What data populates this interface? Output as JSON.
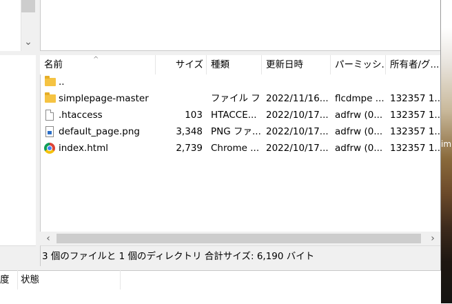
{
  "columns": [
    {
      "key": "name",
      "label": "名前"
    },
    {
      "key": "size",
      "label": "サイズ"
    },
    {
      "key": "type",
      "label": "種類"
    },
    {
      "key": "modified",
      "label": "更新日時"
    },
    {
      "key": "permissions",
      "label": "パーミッシ..."
    },
    {
      "key": "owner",
      "label": "所有者/グ..."
    }
  ],
  "files": [
    {
      "icon": "folder-icon",
      "name": "..",
      "size": "",
      "type": "",
      "modified": "",
      "permissions": "",
      "owner": ""
    },
    {
      "icon": "folder-icon",
      "name": "simplepage-master",
      "size": "",
      "type": "ファイル フ...",
      "modified": "2022/11/16...",
      "permissions": "flcdmpe ...",
      "owner": "132357 1..."
    },
    {
      "icon": "text-file-icon",
      "name": ".htaccess",
      "size": "103",
      "type": "HTACCE...",
      "modified": "2022/10/17...",
      "permissions": "adfrw (0...",
      "owner": "132357 1..."
    },
    {
      "icon": "png-file-icon",
      "name": "default_page.png",
      "size": "3,348",
      "type": "PNG ファ...",
      "modified": "2022/10/17...",
      "permissions": "adfrw (0...",
      "owner": "132357 1..."
    },
    {
      "icon": "chrome-icon",
      "name": "index.html",
      "size": "2,739",
      "type": "Chrome ...",
      "modified": "2022/10/17...",
      "permissions": "adfrw (0...",
      "owner": "132357 1..."
    }
  ],
  "status": "3 個のファイルと 1 個のディレクトリ 合計サイズ: 6,190 バイト",
  "queue_columns": [
    "度",
    "状態"
  ],
  "desktop_text": "im",
  "scroll": {
    "up": "▲",
    "down": "⌄",
    "left": "‹",
    "right": "›",
    "sort": "^"
  }
}
